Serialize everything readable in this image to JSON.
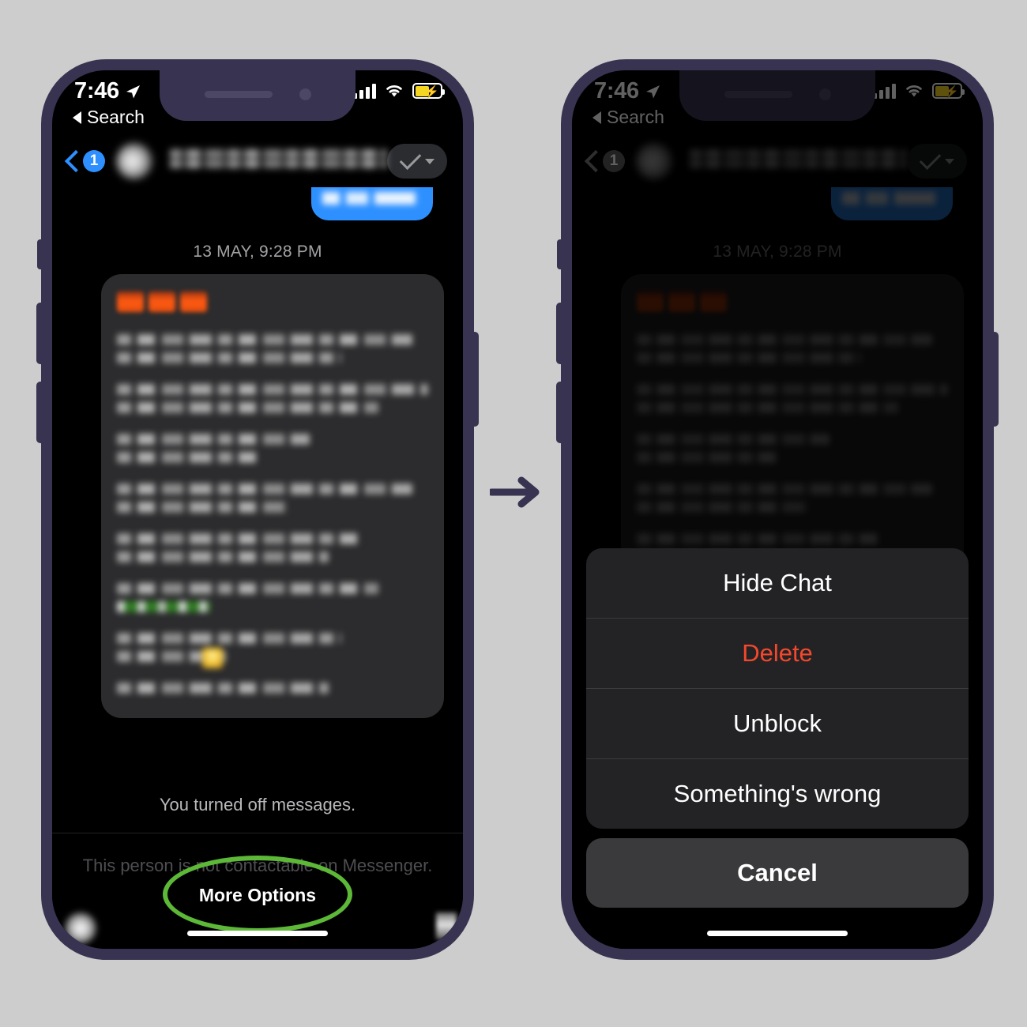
{
  "meta": {
    "background_color": "#cdcdcd",
    "frame_color": "#383350",
    "accent_blue": "#2e8fff",
    "destructive_red": "#f4482c",
    "highlight_green": "#5cb836",
    "arrow_color": "#383350"
  },
  "status_bar": {
    "time": "7:46",
    "location_icon": "location-arrow-icon",
    "back_app_label": "Search",
    "signal_icon": "cellular-bars-icon",
    "wifi_icon": "wifi-icon",
    "battery_icon": "battery-charging-icon",
    "battery_charging": true
  },
  "nav_bar": {
    "back_icon": "chevron-left-icon",
    "unread_badge": "1",
    "avatar": "contact-avatar",
    "contact_name": "",
    "action_icon": "checkmark-chevron-icon"
  },
  "compose_pill": {
    "label": ""
  },
  "chat": {
    "timestamp": "13 MAY, 9:28 PM",
    "bubble": {
      "reaction_emojis": [
        "emoji-1",
        "emoji-2",
        "emoji-3"
      ],
      "paragraphs": [
        {
          "id": "p1",
          "lines": [
            "w95",
            "w72"
          ]
        },
        {
          "id": "p2",
          "lines": [
            "w100",
            "w84"
          ]
        },
        {
          "id": "p3",
          "lines": [
            "w62",
            "w45"
          ]
        },
        {
          "id": "p4",
          "lines": [
            "w95",
            "w55"
          ]
        },
        {
          "id": "p5",
          "lines": [
            "w78",
            "w68"
          ]
        },
        {
          "id": "p6",
          "lines": [
            "w84",
            "green"
          ]
        },
        {
          "id": "p7",
          "lines": [
            "w72",
            "gold"
          ]
        },
        {
          "id": "p8",
          "lines": [
            "w68"
          ]
        }
      ]
    }
  },
  "footer": {
    "messages_off_notice": "You turned off messages.",
    "not_contactable_notice": "This person is not contactable on Messenger.",
    "more_options_label": "More Options",
    "highlight_annotation": "green-ellipse-highlight"
  },
  "action_sheet": {
    "items": [
      {
        "label": "Hide Chat",
        "style": "default"
      },
      {
        "label": "Delete",
        "style": "destructive"
      },
      {
        "label": "Unblock",
        "style": "default"
      },
      {
        "label": "Something's wrong",
        "style": "default"
      }
    ],
    "cancel_label": "Cancel"
  },
  "transition": {
    "arrow_icon": "arrow-right-icon"
  }
}
